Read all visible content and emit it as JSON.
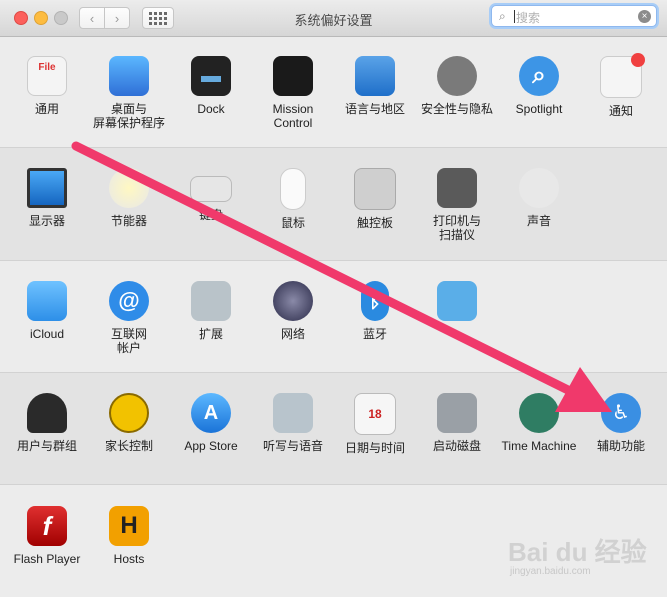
{
  "window": {
    "title": "系统偏好设置"
  },
  "toolbar": {
    "back": "‹",
    "forward": "›"
  },
  "search": {
    "placeholder": "搜索",
    "clear": "×",
    "icon": "magnifier-icon"
  },
  "rows": [
    [
      {
        "label": "通用",
        "icon": "general-icon"
      },
      {
        "label": "桌面与\n屏幕保护程序",
        "icon": "desktop-screensaver-icon"
      },
      {
        "label": "Dock",
        "icon": "dock-icon"
      },
      {
        "label": "Mission\nControl",
        "icon": "mission-control-icon"
      },
      {
        "label": "语言与地区",
        "icon": "language-region-icon"
      },
      {
        "label": "安全性与隐私",
        "icon": "security-privacy-icon"
      },
      {
        "label": "Spotlight",
        "icon": "spotlight-icon"
      },
      {
        "label": "通知",
        "icon": "notifications-icon"
      }
    ],
    [
      {
        "label": "显示器",
        "icon": "displays-icon"
      },
      {
        "label": "节能器",
        "icon": "energy-saver-icon"
      },
      {
        "label": "键盘",
        "icon": "keyboard-icon"
      },
      {
        "label": "鼠标",
        "icon": "mouse-icon"
      },
      {
        "label": "触控板",
        "icon": "trackpad-icon"
      },
      {
        "label": "打印机与\n扫描仪",
        "icon": "printers-scanners-icon"
      },
      {
        "label": "声音",
        "icon": "sound-icon"
      }
    ],
    [
      {
        "label": "iCloud",
        "icon": "icloud-icon"
      },
      {
        "label": "互联网\n帐户",
        "icon": "internet-accounts-icon"
      },
      {
        "label": "扩展",
        "icon": "extensions-icon"
      },
      {
        "label": "网络",
        "icon": "network-icon"
      },
      {
        "label": "蓝牙",
        "icon": "bluetooth-icon"
      },
      {
        "label": "",
        "icon": "sharing-icon"
      }
    ],
    [
      {
        "label": "用户与群组",
        "icon": "users-groups-icon"
      },
      {
        "label": "家长控制",
        "icon": "parental-controls-icon"
      },
      {
        "label": "App Store",
        "icon": "app-store-icon"
      },
      {
        "label": "听写与语音",
        "icon": "dictation-speech-icon"
      },
      {
        "label": "日期与时间",
        "icon": "date-time-icon"
      },
      {
        "label": "启动磁盘",
        "icon": "startup-disk-icon"
      },
      {
        "label": "Time Machine",
        "icon": "time-machine-icon"
      },
      {
        "label": "辅助功能",
        "icon": "accessibility-icon"
      }
    ],
    [
      {
        "label": "Flash Player",
        "icon": "flash-player-icon"
      },
      {
        "label": "Hosts",
        "icon": "hosts-icon"
      }
    ]
  ],
  "icon_glyphs": {
    "general-icon": "File",
    "dock-icon": "▬",
    "spotlight-icon": "⌕",
    "internet-accounts-icon": "@",
    "bluetooth-icon": "ᛒ",
    "app-store-icon": "A",
    "date-time-icon": "18",
    "flash-player-icon": "f",
    "hosts-icon": "H",
    "accessibility-icon": "♿"
  },
  "colors": {
    "annotation_arrow": "#f0396b"
  },
  "watermark": {
    "brand": "Bai du 经验",
    "url": "jingyan.baidu.com"
  }
}
